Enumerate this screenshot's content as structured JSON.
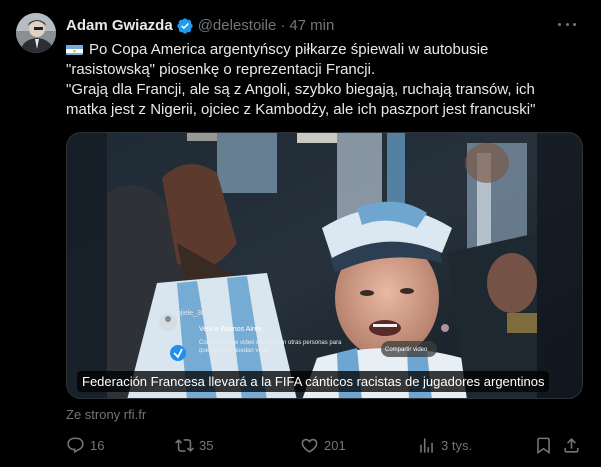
{
  "tweet": {
    "author_name": "Adam Gwiazda",
    "handle": "@delestoile",
    "separator": "·",
    "time": "47 min",
    "text_lines": [
      "Po Copa America argentyńscy piłkarze śpiewali w autobusie",
      "\"rasistowską\" piosenkę o reprezentacji Francji.",
      "\"Grają dla Francji, ale są z Angoli, szybko biegają, ruchają transów, ich",
      "matka jest z Nigerii, ojciec z Kambodży, ale ich paszport jest francuski\""
    ],
    "media": {
      "caption": "Federación Francesa llevará a la FIFA cánticos racistas de jugadores argentinos",
      "live_user": "tojiele_3012",
      "live_message": "Veni a Buenos Aires",
      "share_text": "Comparte este video en vivo con otras personas para que también puedan verlo.",
      "share_button": "Compartir video"
    },
    "source": "Ze strony rfi.fr",
    "actions": {
      "replies": "16",
      "reposts": "35",
      "likes": "201",
      "views": "3 tys."
    }
  },
  "icons": {
    "verified": "verified-badge-icon",
    "more": "more-icon",
    "flag": "argentina-flag-icon",
    "reply": "reply-icon",
    "repost": "repost-icon",
    "like": "heart-icon",
    "views": "views-icon",
    "bookmark": "bookmark-icon",
    "share": "share-icon"
  },
  "colors": {
    "background": "#000000",
    "text": "#e7e9ea",
    "secondary": "#71767b",
    "verified": "#1d9bf0"
  }
}
